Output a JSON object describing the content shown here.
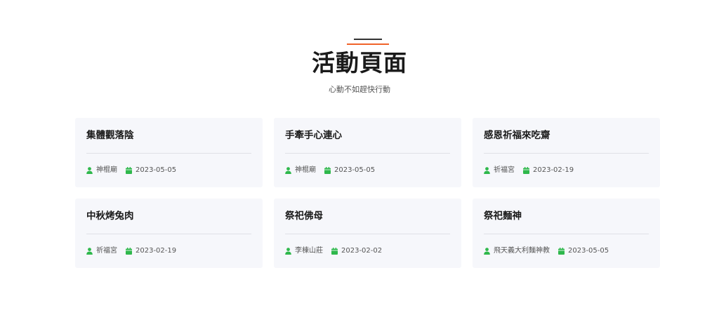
{
  "header": {
    "title": "活動頁面",
    "subtitle": "心動不如趕快行動",
    "accent_color": "#f0632a"
  },
  "icons": {
    "author": "user-icon",
    "date": "calendar-icon",
    "icon_color": "#2fb84c"
  },
  "events": [
    {
      "title": "集體觀落陰",
      "author": "神棍廟",
      "date": "2023-05-05"
    },
    {
      "title": "手牽手心連心",
      "author": "神棍廟",
      "date": "2023-05-05"
    },
    {
      "title": "感恩祈福來吃齋",
      "author": "祈福宮",
      "date": "2023-02-19"
    },
    {
      "title": "中秋烤兔肉",
      "author": "祈福宮",
      "date": "2023-02-19"
    },
    {
      "title": "祭祀佛母",
      "author": "李棟山莊",
      "date": "2023-02-02"
    },
    {
      "title": "祭祀麵神",
      "author": "飛天義大利麵神教",
      "date": "2023-05-05"
    }
  ]
}
